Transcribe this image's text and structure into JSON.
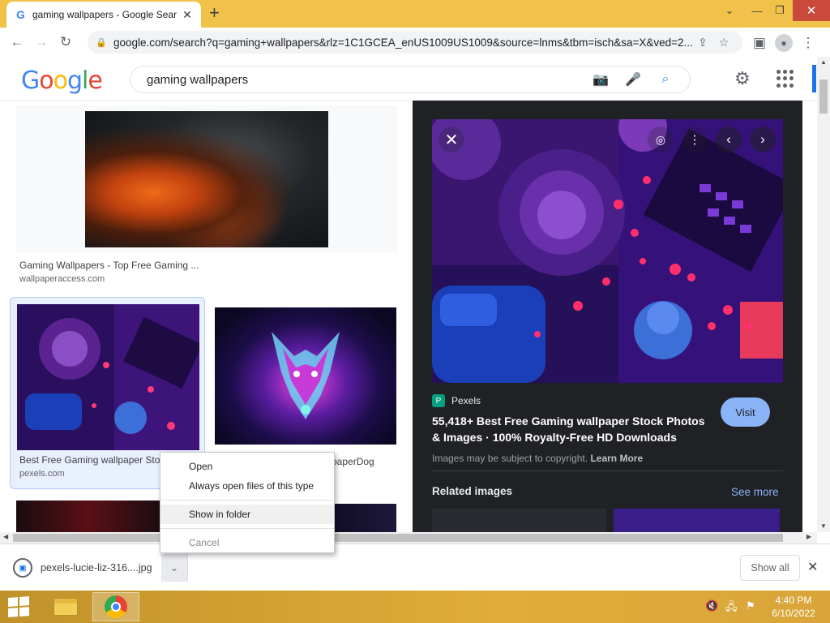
{
  "browser": {
    "tab_title": "gaming wallpapers - Google Sear",
    "tab_favicon": "G",
    "url": "google.com/search?q=gaming+wallpapers&rlz=1C1GCEA_enUS1009US1009&source=lnms&tbm=isch&sa=X&ved=2..."
  },
  "google": {
    "logo_letters": [
      "G",
      "o",
      "o",
      "g",
      "l",
      "e"
    ],
    "logo_colors": [
      "#4285f4",
      "#ea4335",
      "#fbbc05",
      "#4285f4",
      "#34a853",
      "#ea4335"
    ],
    "query": "gaming wallpapers"
  },
  "results": [
    {
      "title": "Gaming Wallpapers - Top Free Gaming ...",
      "source": "wallpaperaccess.com"
    },
    {
      "title": "Best Free Gaming wallpaper Sto",
      "source": "pexels.com"
    },
    {
      "title": "paperDog",
      "source": ""
    }
  ],
  "preview": {
    "source_name": "Pexels",
    "source_icon": "P",
    "title": "55,418+ Best Free Gaming wallpaper Stock Photos & Images · 100% Royalty-Free HD Downloads",
    "visit_label": "Visit",
    "copyright_text": "Images may be subject to copyright.",
    "learn_more": "Learn More",
    "related_label": "Related images",
    "see_more": "See more"
  },
  "context_menu": {
    "items": [
      "Open",
      "Always open files of this type",
      "Show in folder",
      "Cancel"
    ]
  },
  "download": {
    "filename": "pexels-lucie-liz-316....jpg",
    "show_all": "Show all"
  },
  "taskbar": {
    "time": "4:40 PM",
    "date": "6/10/2022"
  }
}
